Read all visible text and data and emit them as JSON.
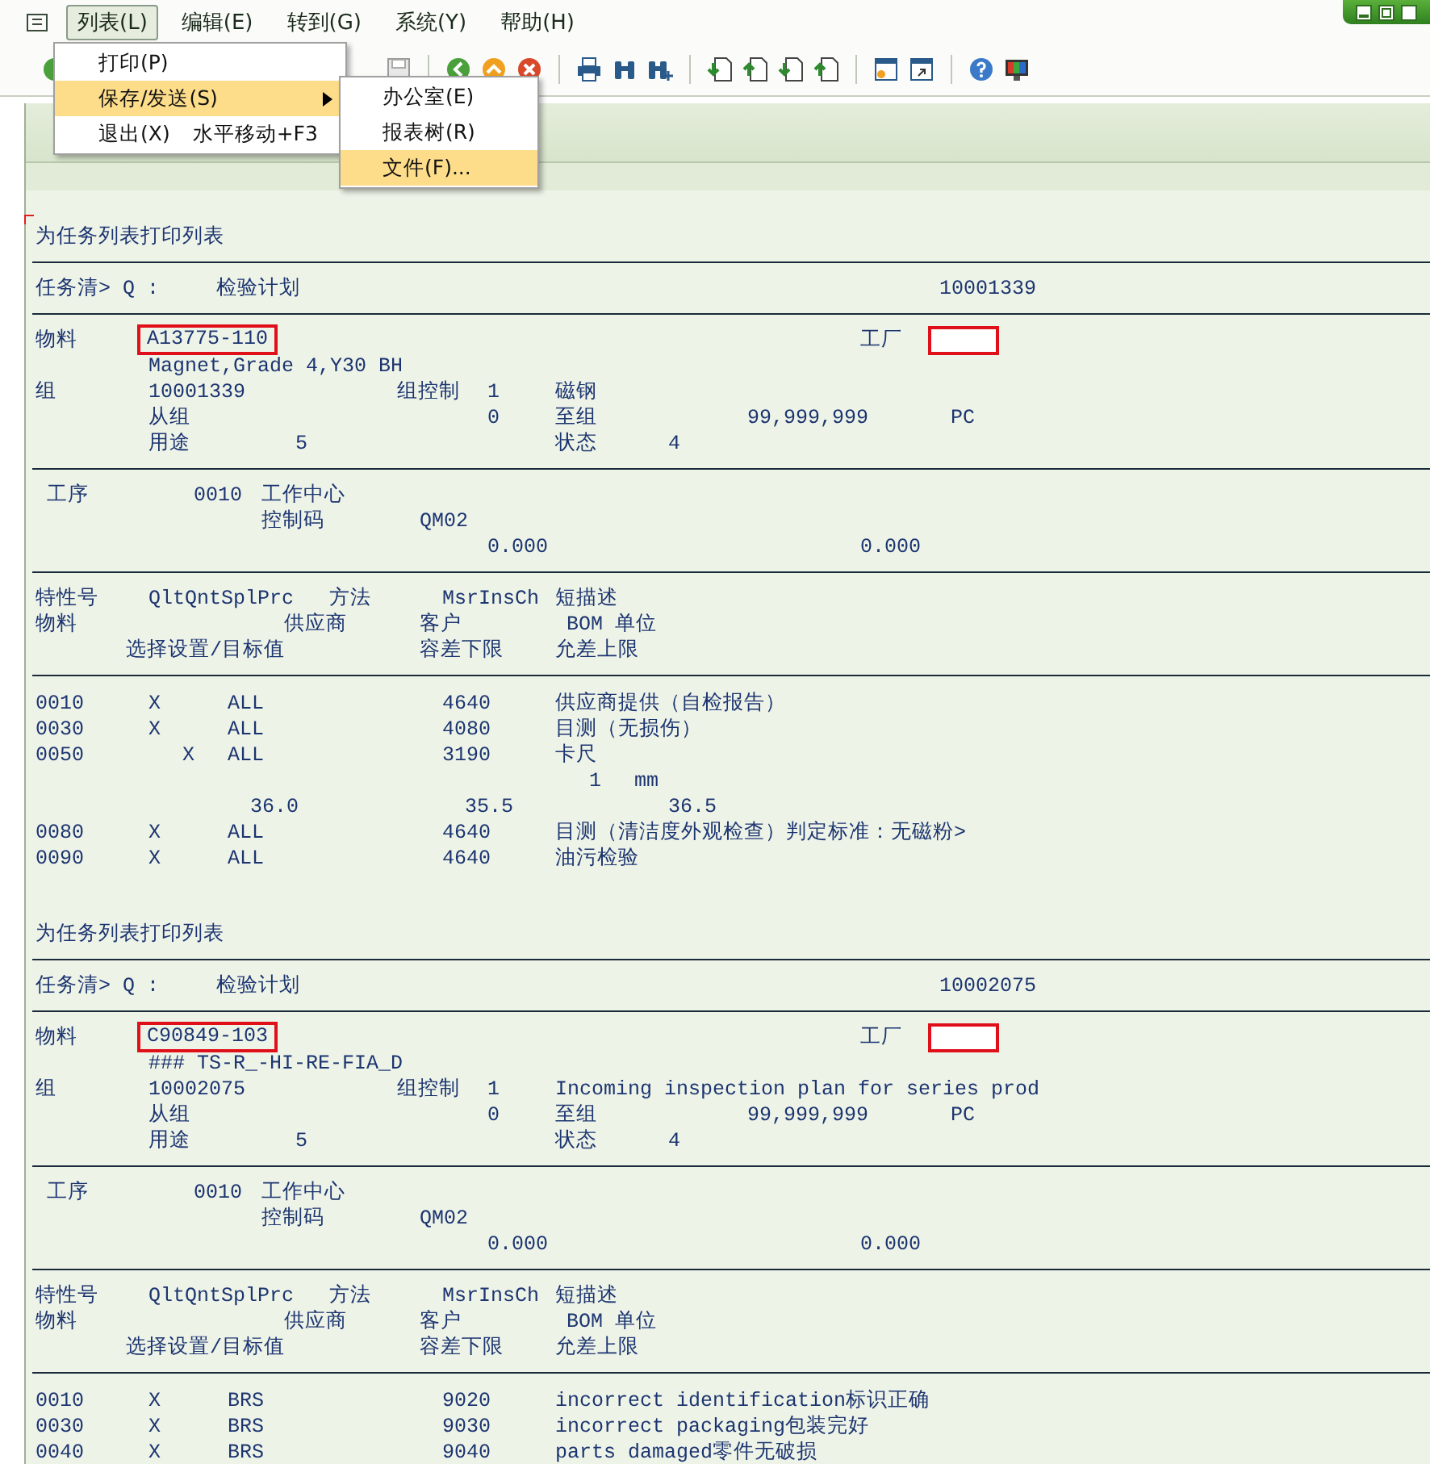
{
  "menu_bar": {
    "items": [
      {
        "label": "列表(L)",
        "selected": true
      },
      {
        "label": "编辑(E)",
        "selected": false
      },
      {
        "label": "转到(G)",
        "selected": false
      },
      {
        "label": "系统(Y)",
        "selected": false
      },
      {
        "label": "帮助(H)",
        "selected": false
      }
    ]
  },
  "dropdown": {
    "items": [
      {
        "label": "打印(P)",
        "selected": false,
        "submenu": false
      },
      {
        "label": "保存/发送(S)",
        "selected": true,
        "submenu": true
      },
      {
        "label": "退出(X)",
        "shortcut": "水平移动+F3",
        "selected": false,
        "submenu": false
      }
    ]
  },
  "submenu": {
    "items": [
      {
        "label": "办公室(E)",
        "selected": false
      },
      {
        "label": "报表树(R)",
        "selected": false
      },
      {
        "label": "文件(F)...",
        "selected": true
      }
    ]
  },
  "reports": [
    {
      "title": "为任务列表打印列表",
      "task_list_label": "任务清> Q :",
      "task_list_type": "检验计划",
      "task_list_number": "10001339",
      "material_label": "物料",
      "material": "A13775-110",
      "material_highlighted": true,
      "plant_label": "工厂",
      "plant_highlighted": true,
      "material_description": "Magnet,Grade 4,Y30 BH",
      "group_label": "组",
      "group": "10001339",
      "group_counter_label": "组控制",
      "group_counter": "1",
      "group_description": "磁钢",
      "from_label": "从组",
      "from_value": "0",
      "to_label": "至组",
      "to_value": "99,999,999",
      "unit": "PC",
      "usage_label": "用途",
      "usage": "5",
      "status_label": "状态",
      "status": "4",
      "operation": {
        "label": "工序",
        "number": "0010",
        "work_center_label": "工作中心",
        "control_key_label": "控制码",
        "control_key": "QM02",
        "value_1": "0.000",
        "value_2": "0.000"
      },
      "header_line_1": [
        "特性号",
        "QltQntSplPrc",
        "方法",
        "MsrInsCh",
        "短描述"
      ],
      "header_line_2": [
        "物料",
        "供应商",
        "客户",
        "BOM 单位"
      ],
      "header_line_3": [
        "选择设置/目标值",
        "容差下限",
        "允差上限"
      ],
      "rows": [
        {
          "kind": "characteristic",
          "number": "0010",
          "flag_1": "X",
          "method": "ALL",
          "inspection_method": "4640",
          "description": "供应商提供（自检报告）"
        },
        {
          "kind": "characteristic",
          "number": "0030",
          "flag_1": "X",
          "method": "ALL",
          "inspection_method": "4080",
          "description": "目测（无损伤）"
        },
        {
          "kind": "characteristic",
          "number": "0050",
          "flag_2": "X",
          "method": "ALL",
          "inspection_method": "3190",
          "description": "卡尺"
        },
        {
          "kind": "quantity",
          "value": "1",
          "unit": "mm"
        },
        {
          "kind": "limits",
          "target": "36.0",
          "lower": "35.5",
          "upper": "36.5"
        },
        {
          "kind": "characteristic",
          "number": "0080",
          "flag_1": "X",
          "method": "ALL",
          "inspection_method": "4640",
          "description": "目测（清洁度外观检查）判定标准：无磁粉>"
        },
        {
          "kind": "characteristic",
          "number": "0090",
          "flag_1": "X",
          "method": "ALL",
          "inspection_method": "4640",
          "description": "油污检验"
        }
      ]
    },
    {
      "title": "为任务列表打印列表",
      "task_list_label": "任务清> Q :",
      "task_list_type": "检验计划",
      "task_list_number": "10002075",
      "material_label": "物料",
      "material": "C90849-103",
      "material_highlighted": true,
      "plant_label": "工厂",
      "plant_highlighted": true,
      "material_description": "### TS-R_-HI-RE-FIA_D",
      "group_label": "组",
      "group": "10002075",
      "group_counter_label": "组控制",
      "group_counter": "1",
      "group_description": "Incoming inspection plan for series prod",
      "from_label": "从组",
      "from_value": "0",
      "to_label": "至组",
      "to_value": "99,999,999",
      "unit": "PC",
      "usage_label": "用途",
      "usage": "5",
      "status_label": "状态",
      "status": "4",
      "operation": {
        "label": "工序",
        "number": "0010",
        "work_center_label": "工作中心",
        "control_key_label": "控制码",
        "control_key": "QM02",
        "value_1": "0.000",
        "value_2": "0.000"
      },
      "header_line_1": [
        "特性号",
        "QltQntSplPrc",
        "方法",
        "MsrInsCh",
        "短描述"
      ],
      "header_line_2": [
        "物料",
        "供应商",
        "客户",
        "BOM 单位"
      ],
      "header_line_3": [
        "选择设置/目标值",
        "容差下限",
        "允差上限"
      ],
      "rows": [
        {
          "kind": "characteristic",
          "number": "0010",
          "flag_1": "X",
          "method": "BRS",
          "inspection_method": "9020",
          "description": "incorrect identification标识正确"
        },
        {
          "kind": "characteristic",
          "number": "0030",
          "flag_1": "X",
          "method": "BRS",
          "inspection_method": "9030",
          "description": "incorrect packaging包装完好"
        },
        {
          "kind": "characteristic",
          "number": "0040",
          "flag_1": "X",
          "method": "BRS",
          "inspection_method": "9040",
          "description": "parts damaged零件无破损"
        }
      ]
    }
  ]
}
